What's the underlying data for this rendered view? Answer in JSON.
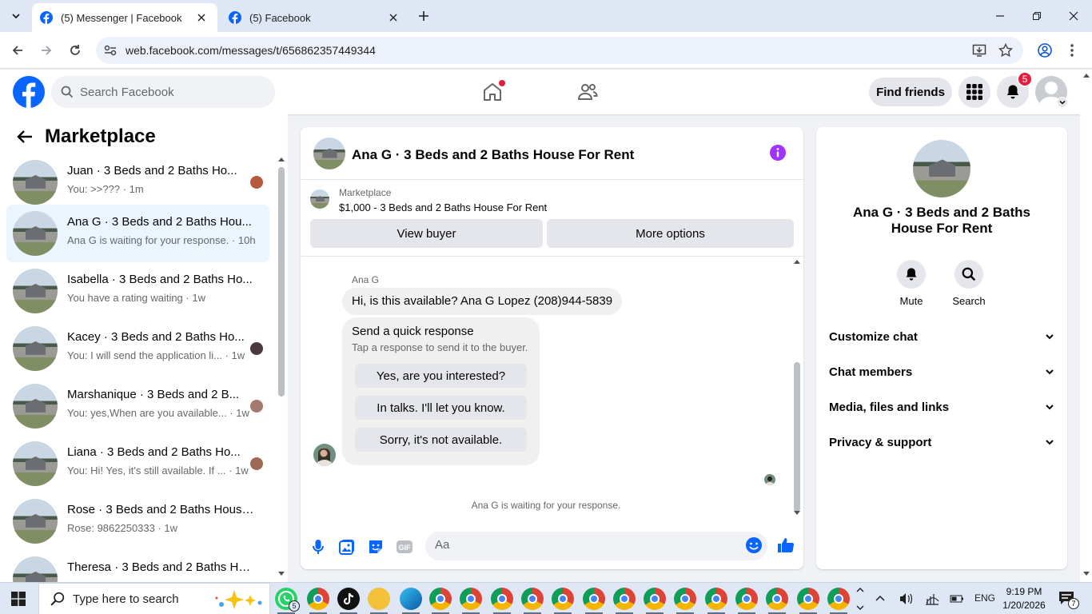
{
  "browser": {
    "tabs": [
      {
        "title": "(5) Messenger | Facebook",
        "active": true
      },
      {
        "title": "(5) Facebook",
        "active": false
      }
    ],
    "url": "web.facebook.com/messages/t/656862357449344"
  },
  "header": {
    "search_placeholder": "Search Facebook",
    "find_friends": "Find friends",
    "notification_count": "5"
  },
  "sidebar": {
    "title": "Marketplace",
    "conversations": [
      {
        "name": "Juan · 3 Beds and 2 Baths Ho...",
        "preview": "You: >>??? · 1m",
        "selected": false
      },
      {
        "name": "Ana G · 3 Beds and 2 Baths Hou...",
        "preview": "Ana G is waiting for your response. · 10h",
        "selected": true
      },
      {
        "name": "Isabella · 3 Beds and 2 Baths Ho...",
        "preview": "You have a rating waiting · 1w",
        "selected": false
      },
      {
        "name": "Kacey · 3 Beds and 2 Baths Ho...",
        "preview": "You: I will send the application li... · 1w",
        "selected": false
      },
      {
        "name": "Marshanique · 3 Beds and 2 B...",
        "preview": "You: yes,When are you available... · 1w",
        "selected": false
      },
      {
        "name": "Liana · 3 Beds and 2 Baths Ho...",
        "preview": "You: Hi! Yes, it's still available. If ... · 1w",
        "selected": false
      },
      {
        "name": "Rose · 3 Beds and 2 Baths House...",
        "preview": "Rose: 9862250333 · 1w",
        "selected": false
      },
      {
        "name": "Theresa · 3 Beds and 2 Baths Ho...",
        "preview": "",
        "selected": false
      }
    ]
  },
  "chat": {
    "title": "Ana G · 3 Beds and 2 Baths House For Rent",
    "marketplace_label": "Marketplace",
    "listing": "$1,000 - 3 Beds and 2 Baths House For Rent",
    "view_buyer": "View buyer",
    "more_options": "More options",
    "sender": "Ana G",
    "message": "Hi, is this available? Ana G Lopez (208)944-5839",
    "quick_title": "Send a quick response",
    "quick_sub": "Tap a response to send it to the buyer.",
    "quick_options": [
      "Yes, are you interested?",
      "In talks. I'll let you know.",
      "Sorry, it's not available."
    ],
    "waiting": "Ana G is waiting for your response.",
    "input_placeholder": "Aa"
  },
  "info": {
    "name": "Ana G · 3 Beds and 2 Baths House For Rent",
    "mute": "Mute",
    "search": "Search",
    "sections": [
      "Customize chat",
      "Chat members",
      "Media, files and links",
      "Privacy & support"
    ]
  },
  "taskbar": {
    "search_placeholder": "Type here to search",
    "whatsapp_badge": "5",
    "lang": "ENG",
    "time": "9:19 PM",
    "date": "1/20/2026",
    "notif_count": "7"
  },
  "colors": {
    "fb_blue": "#0866ff",
    "messenger_purple": "#a033ff",
    "badge_red": "#e41e3f",
    "selected_row": "#ebf5ff"
  }
}
